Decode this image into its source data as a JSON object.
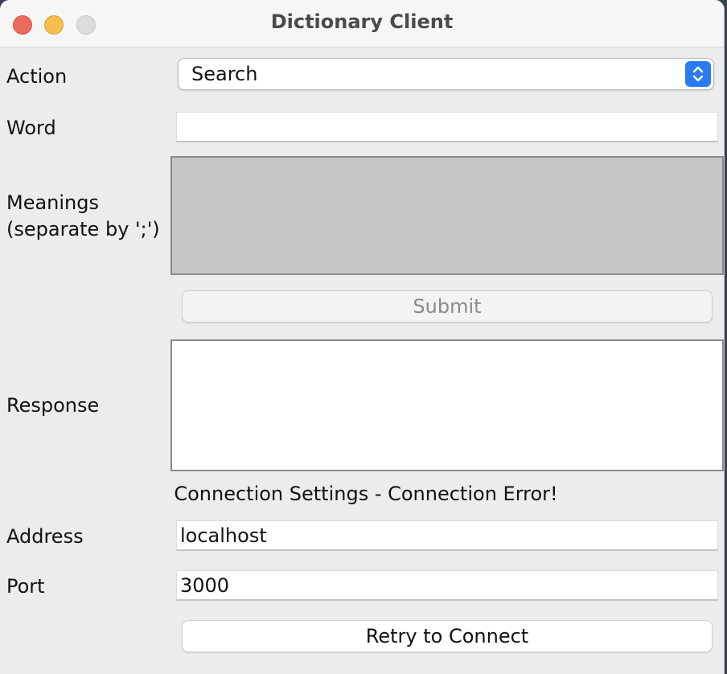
{
  "window": {
    "title": "Dictionary Client"
  },
  "form": {
    "action_label": "Action",
    "action_value": "Search",
    "word_label": "Word",
    "word_value": "",
    "meanings_label_line1": "Meanings",
    "meanings_label_line2": "(separate by ';')",
    "meanings_value": "",
    "submit_label": "Submit",
    "response_label": "Response",
    "response_value": ""
  },
  "connection": {
    "status_text": "Connection Settings - Connection Error!",
    "address_label": "Address",
    "address_value": "localhost",
    "port_label": "Port",
    "port_value": "3000",
    "retry_label": "Retry to Connect"
  },
  "colors": {
    "close": "#ed6a5e",
    "minimize": "#f5bf4f",
    "maximize": "#dcdcdc",
    "select_accent": "#2a7bf2",
    "disabled_area": "#c6c6c6"
  },
  "icons": {
    "select_arrows": "chevron-up-down-icon"
  }
}
